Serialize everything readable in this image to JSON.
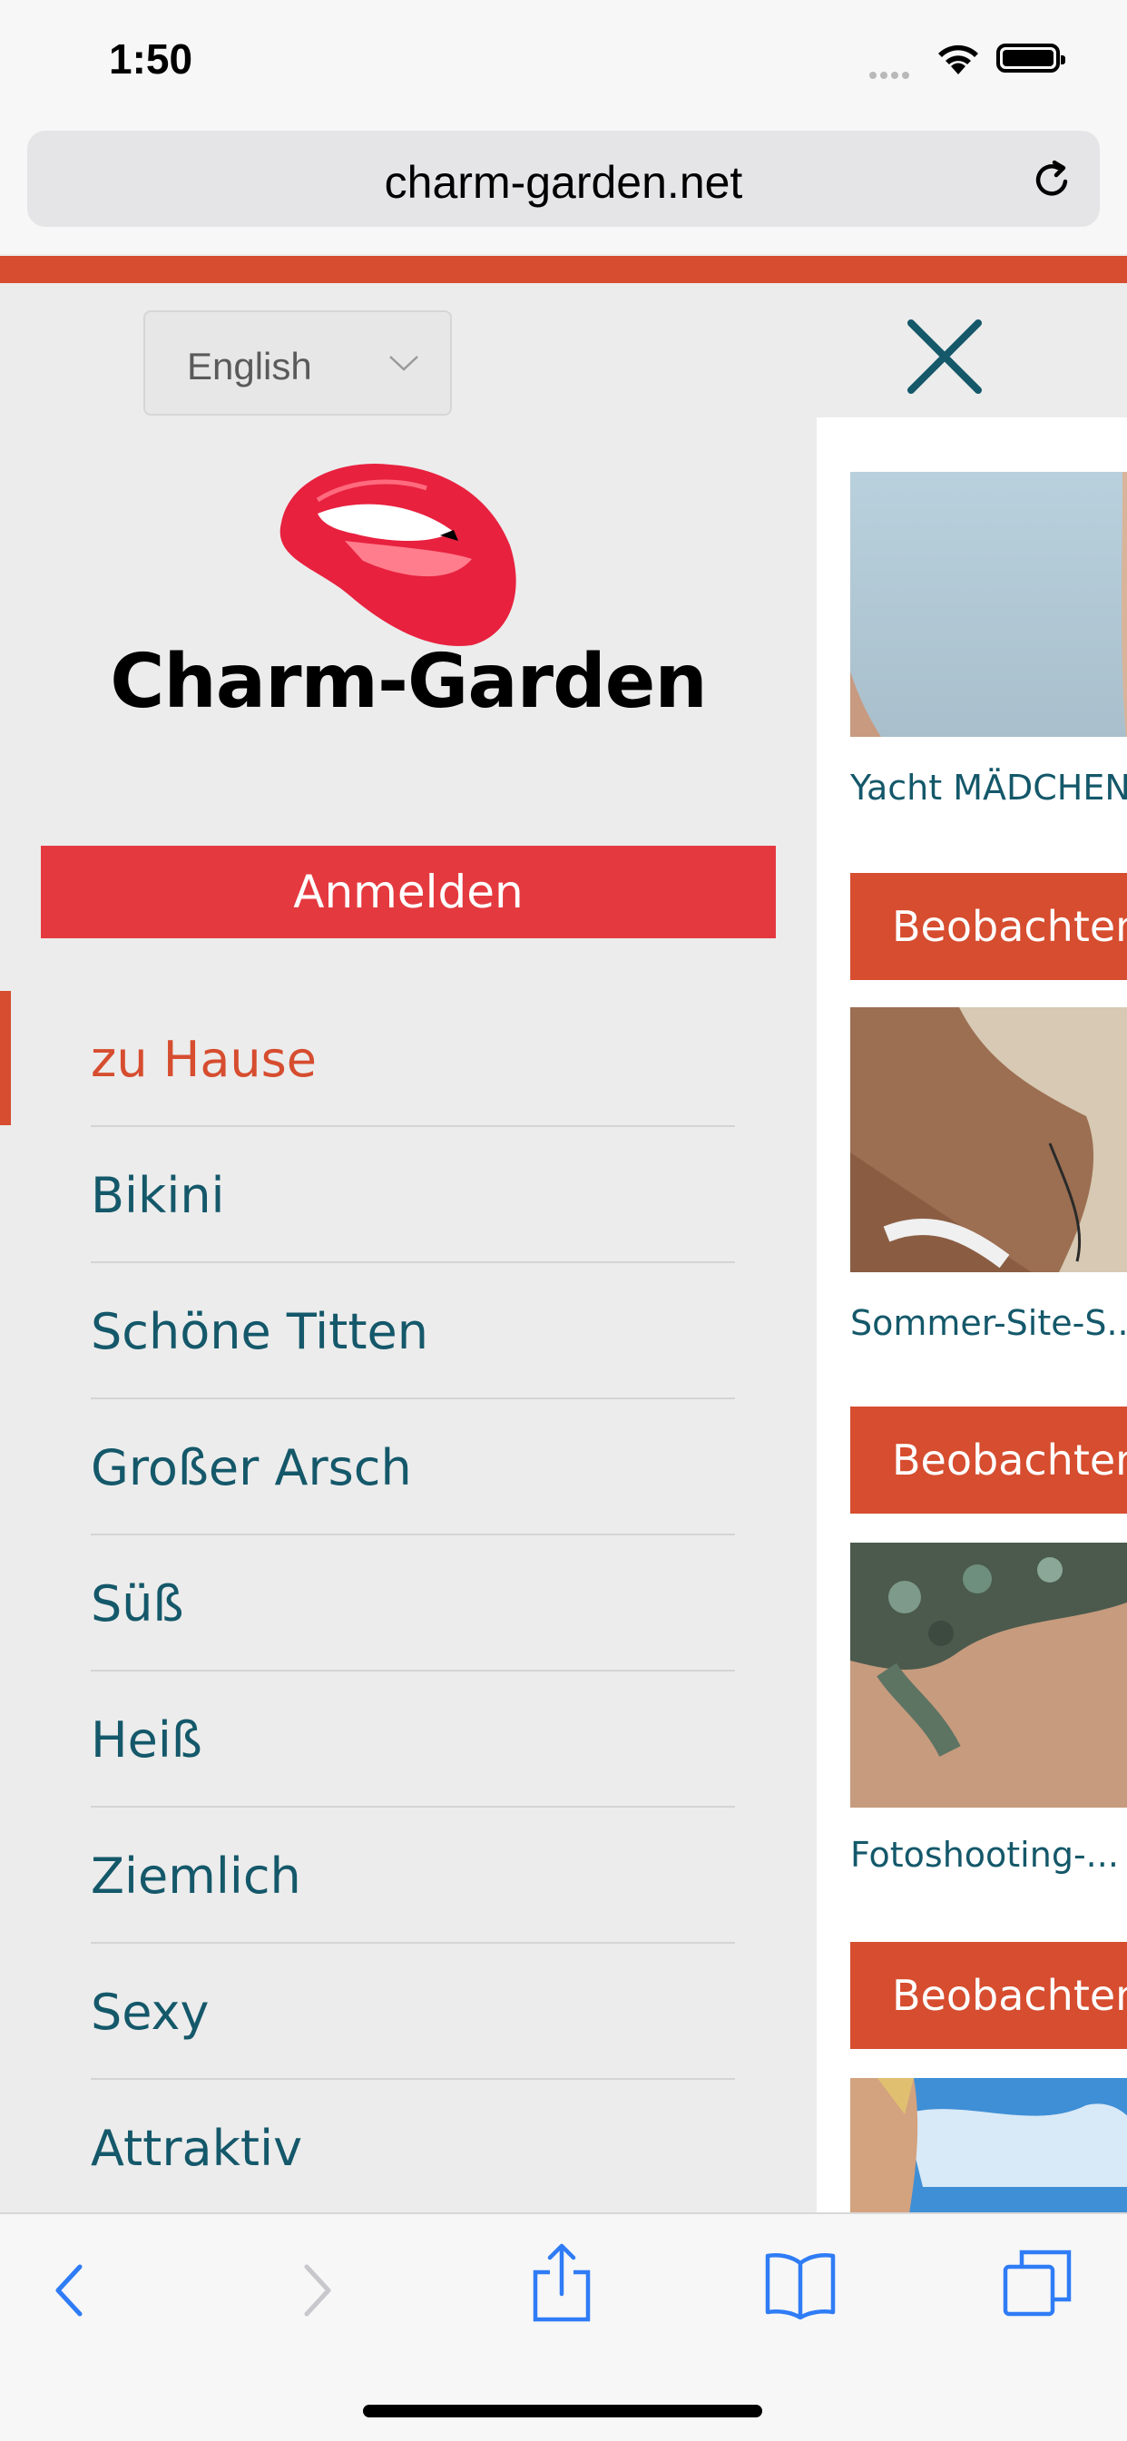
{
  "status_bar": {
    "time": "1:50"
  },
  "browser": {
    "url": "charm-garden.net",
    "reload_icon": "reload-icon"
  },
  "drawer": {
    "language": "English",
    "logo_text": "Charm-Garden",
    "login_label": "Anmelden",
    "menu": [
      {
        "label": "zu Hause",
        "active": true
      },
      {
        "label": "Bikini"
      },
      {
        "label": "Schöne Titten"
      },
      {
        "label": "Großer Arsch"
      },
      {
        "label": "Süß"
      },
      {
        "label": "Heiß"
      },
      {
        "label": "Ziemlich"
      },
      {
        "label": "Sexy"
      },
      {
        "label": "Attraktiv"
      }
    ]
  },
  "content": {
    "cards": [
      {
        "title": "Yacht MÄDCHEN",
        "button": "Beobachten"
      },
      {
        "title": "Sommer-Site-S...",
        "button": "Beobachten"
      },
      {
        "title": "Fotoshooting-...",
        "button": "Beobachten"
      }
    ]
  },
  "colors": {
    "accent": "#d64d2f",
    "login": "#e43a3f",
    "link": "#14586a"
  }
}
